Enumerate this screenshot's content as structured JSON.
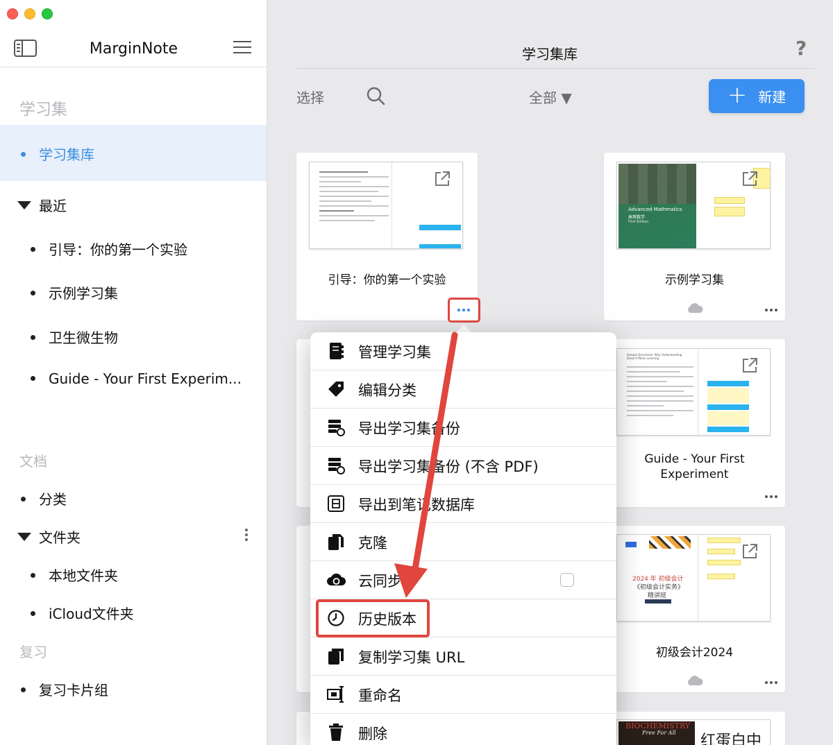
{
  "sidebar": {
    "app_title": "MarginNote",
    "section_study": "学习集",
    "library_item": "学习集库",
    "recent_label": "最近",
    "recent_items": [
      "引导：你的第一个实验",
      "示例学习集",
      "卫生微生物",
      "Guide - Your First Experim..."
    ],
    "section_docs": "文档",
    "category": "分类",
    "folder_label": "文件夹",
    "folders": [
      "本地文件夹",
      "iCloud文件夹"
    ],
    "section_review": "复习",
    "flashcards": "复习卡片组"
  },
  "main": {
    "title": "学习集库",
    "help": "?",
    "select_label": "选择",
    "filter_label": "全部 ▼",
    "new_label": "新建"
  },
  "cards": [
    {
      "title": "引导：你的第一个实验"
    },
    {
      "title": "示例学习集",
      "thumb_text": [
        "Advanced Mathmatics",
        "高等数学",
        "First Edition"
      ]
    },
    {
      "title_line1": "Guide - Your First",
      "title_line2": "Experiment",
      "thumb_text": "Sample Document: Why Understanding Doesn't Mean Learning"
    },
    {
      "title": "初级会计2024",
      "thumb_text": [
        "2024 年 初级会计",
        "《初级会计实务》",
        "精讲班"
      ]
    },
    {
      "thumb_text": [
        "BIOCHEMISTRY",
        "Free For All"
      ]
    },
    {
      "thumb_text": "红蛋白中"
    }
  ],
  "menu": {
    "items": [
      {
        "label": "管理学习集",
        "icon": "notebook-icon"
      },
      {
        "label": "编辑分类",
        "icon": "tag-icon"
      },
      {
        "label": "导出学习集备份",
        "icon": "export-backup-icon"
      },
      {
        "label": "导出学习集备份 (不含 PDF)",
        "icon": "export-backup-no-pdf-icon"
      },
      {
        "label": "导出到笔记数据库",
        "icon": "database-export-icon"
      },
      {
        "label": "克隆",
        "icon": "clone-icon"
      },
      {
        "label": "云同步",
        "icon": "cloud-sync-icon"
      },
      {
        "label": "历史版本",
        "icon": "history-icon"
      },
      {
        "label": "复制学习集 URL",
        "icon": "copy-url-icon"
      },
      {
        "label": "重命名",
        "icon": "rename-icon"
      },
      {
        "label": "删除",
        "icon": "trash-icon"
      }
    ]
  },
  "colors": {
    "accent": "#3a8ff0",
    "selected_bg": "#e7f0fb",
    "annotation": "#e0463e"
  }
}
